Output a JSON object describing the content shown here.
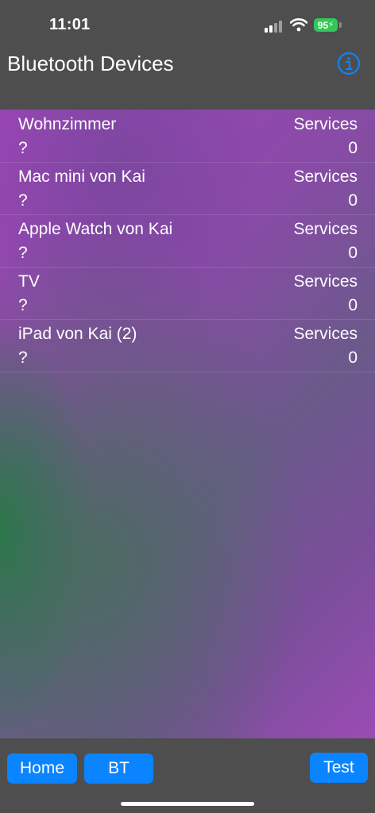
{
  "status_bar": {
    "time": "11:01",
    "battery": "95",
    "icons": [
      "signal-icon",
      "wifi-icon",
      "battery-icon"
    ]
  },
  "nav": {
    "title": "Bluetooth Devices",
    "info_icon": "info-circle-icon"
  },
  "devices": [
    {
      "name": "Wohnzimmer",
      "subtitle": "?",
      "services_label": "Services",
      "services_count": "0"
    },
    {
      "name": "Mac mini von Kai",
      "subtitle": "?",
      "services_label": "Services",
      "services_count": "0"
    },
    {
      "name": "Apple Watch von Kai",
      "subtitle": "?",
      "services_label": "Services",
      "services_count": "0"
    },
    {
      "name": "TV",
      "subtitle": "?",
      "services_label": "Services",
      "services_count": "0"
    },
    {
      "name": "iPad von Kai (2)",
      "subtitle": "?",
      "services_label": "Services",
      "services_count": "0"
    }
  ],
  "tabs": {
    "home_label": "Home",
    "bt_label": "BT",
    "test_label": "Test"
  },
  "colors": {
    "accent": "#0a84ff",
    "battery": "#34c759",
    "bar_background": "#4e4e4e"
  }
}
